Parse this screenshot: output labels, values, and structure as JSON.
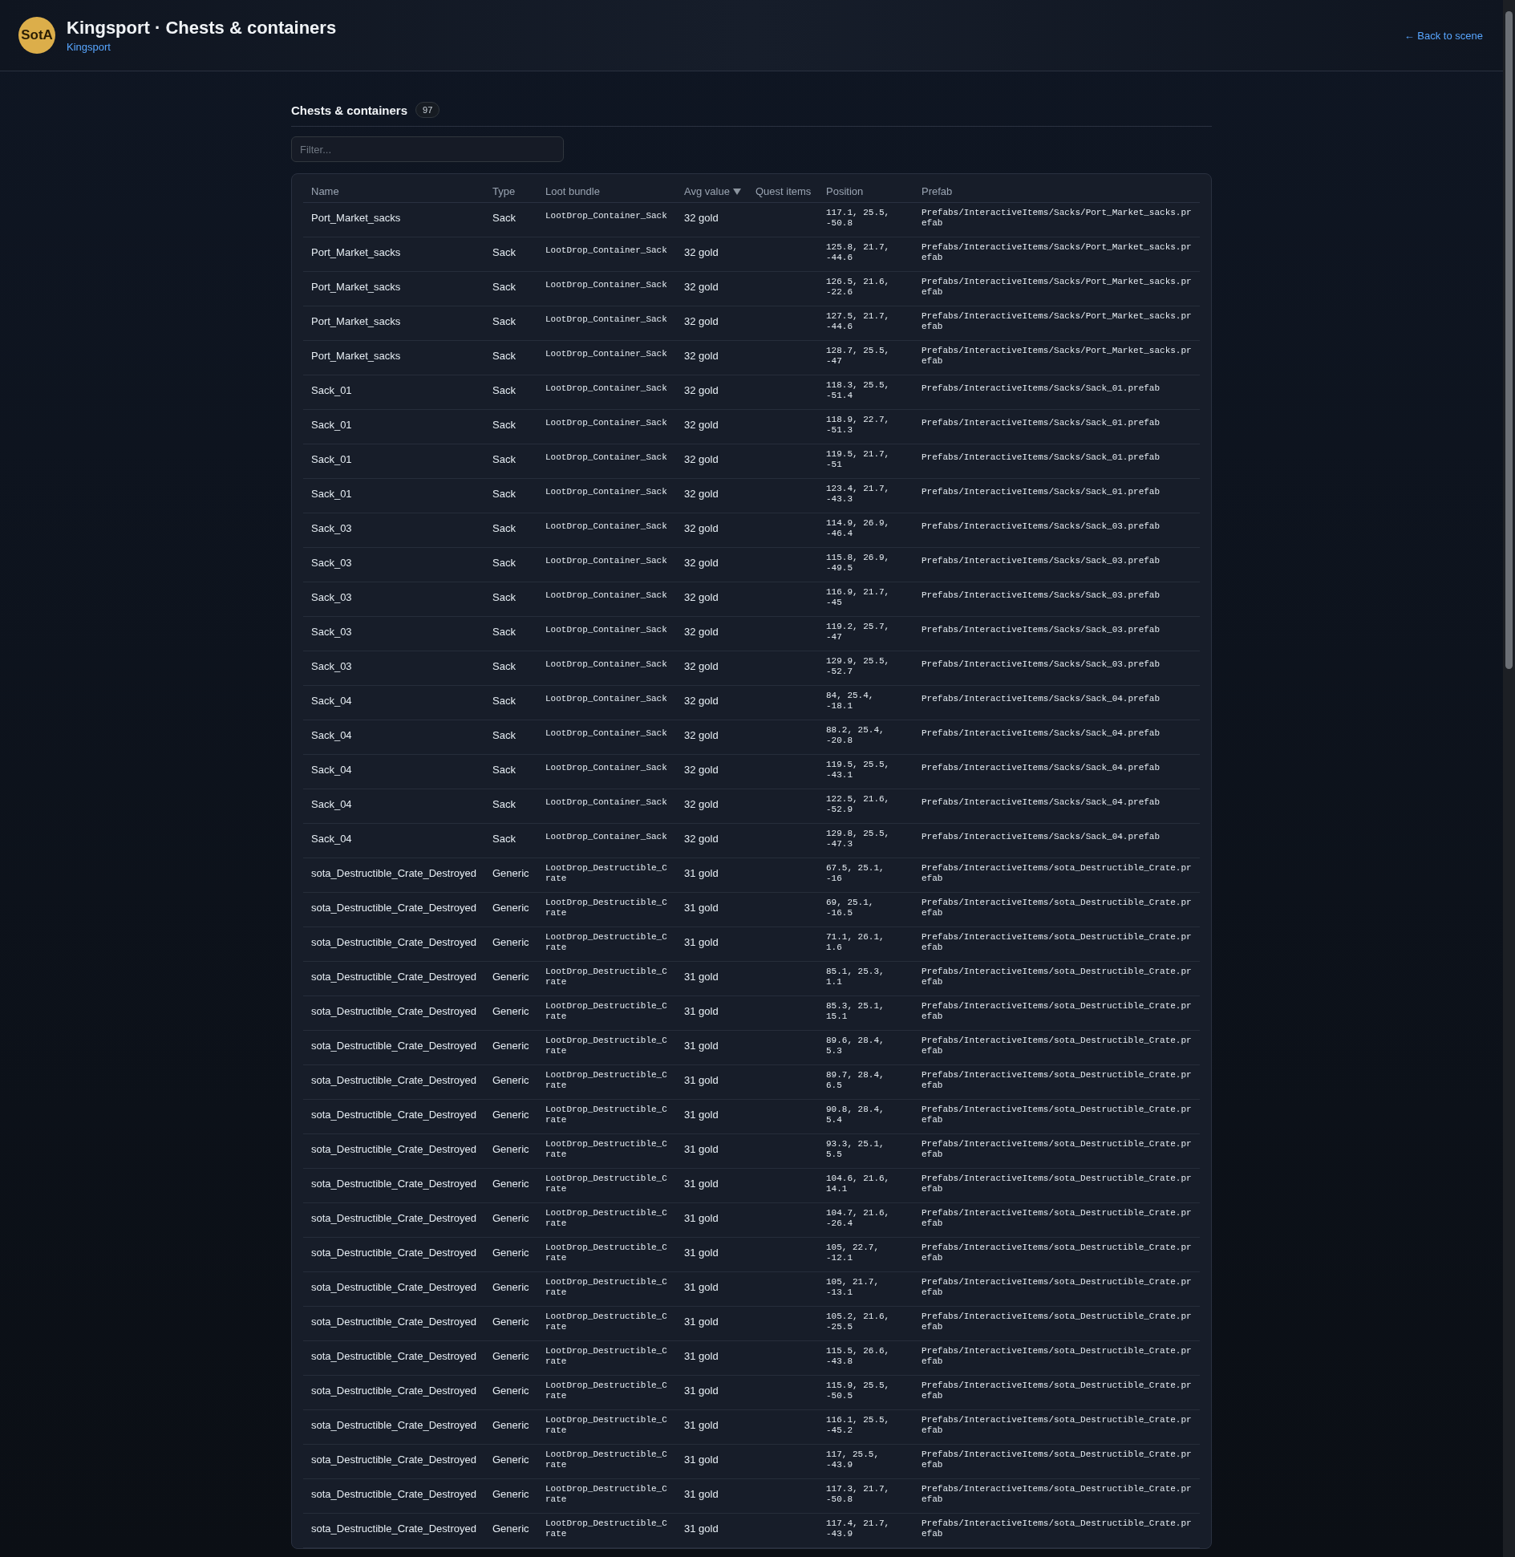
{
  "header": {
    "logo": "SotA",
    "title": "Kingsport · Chests & containers",
    "subtitle": "Kingsport",
    "back_link": "← Back to scene"
  },
  "section": {
    "title": "Chests & containers",
    "count": "97"
  },
  "filter": {
    "placeholder": "Filter..."
  },
  "table": {
    "columns": [
      {
        "label": "Name",
        "sorted": false
      },
      {
        "label": "Type",
        "sorted": false
      },
      {
        "label": "Loot bundle",
        "sorted": false
      },
      {
        "label": "Avg value",
        "sorted": true
      },
      {
        "label": "Quest items",
        "sorted": false
      },
      {
        "label": "Position",
        "sorted": false
      },
      {
        "label": "Prefab",
        "sorted": false
      }
    ],
    "rows": [
      {
        "name": "Port_Market_sacks",
        "type": "Sack",
        "loot_bundle": "LootDrop_Container_Sack",
        "avg_value": "32 gold",
        "position": "117.1, 25.5, -50.8",
        "prefab": "Prefabs/InteractiveItems/Sacks/Port_Market_sacks.prefab"
      },
      {
        "name": "Port_Market_sacks",
        "type": "Sack",
        "loot_bundle": "LootDrop_Container_Sack",
        "avg_value": "32 gold",
        "position": "125.8, 21.7, -44.6",
        "prefab": "Prefabs/InteractiveItems/Sacks/Port_Market_sacks.prefab"
      },
      {
        "name": "Port_Market_sacks",
        "type": "Sack",
        "loot_bundle": "LootDrop_Container_Sack",
        "avg_value": "32 gold",
        "position": "126.5, 21.6, -22.6",
        "prefab": "Prefabs/InteractiveItems/Sacks/Port_Market_sacks.prefab"
      },
      {
        "name": "Port_Market_sacks",
        "type": "Sack",
        "loot_bundle": "LootDrop_Container_Sack",
        "avg_value": "32 gold",
        "position": "127.5, 21.7, -44.6",
        "prefab": "Prefabs/InteractiveItems/Sacks/Port_Market_sacks.prefab"
      },
      {
        "name": "Port_Market_sacks",
        "type": "Sack",
        "loot_bundle": "LootDrop_Container_Sack",
        "avg_value": "32 gold",
        "position": "128.7, 25.5, -47",
        "prefab": "Prefabs/InteractiveItems/Sacks/Port_Market_sacks.prefab"
      },
      {
        "name": "Sack_01",
        "type": "Sack",
        "loot_bundle": "LootDrop_Container_Sack",
        "avg_value": "32 gold",
        "position": "118.3, 25.5, -51.4",
        "prefab": "Prefabs/InteractiveItems/Sacks/Sack_01.prefab"
      },
      {
        "name": "Sack_01",
        "type": "Sack",
        "loot_bundle": "LootDrop_Container_Sack",
        "avg_value": "32 gold",
        "position": "118.9, 22.7, -51.3",
        "prefab": "Prefabs/InteractiveItems/Sacks/Sack_01.prefab"
      },
      {
        "name": "Sack_01",
        "type": "Sack",
        "loot_bundle": "LootDrop_Container_Sack",
        "avg_value": "32 gold",
        "position": "119.5, 21.7, -51",
        "prefab": "Prefabs/InteractiveItems/Sacks/Sack_01.prefab"
      },
      {
        "name": "Sack_01",
        "type": "Sack",
        "loot_bundle": "LootDrop_Container_Sack",
        "avg_value": "32 gold",
        "position": "123.4, 21.7, -43.3",
        "prefab": "Prefabs/InteractiveItems/Sacks/Sack_01.prefab"
      },
      {
        "name": "Sack_03",
        "type": "Sack",
        "loot_bundle": "LootDrop_Container_Sack",
        "avg_value": "32 gold",
        "position": "114.9, 26.9, -46.4",
        "prefab": "Prefabs/InteractiveItems/Sacks/Sack_03.prefab"
      },
      {
        "name": "Sack_03",
        "type": "Sack",
        "loot_bundle": "LootDrop_Container_Sack",
        "avg_value": "32 gold",
        "position": "115.8, 26.9, -49.5",
        "prefab": "Prefabs/InteractiveItems/Sacks/Sack_03.prefab"
      },
      {
        "name": "Sack_03",
        "type": "Sack",
        "loot_bundle": "LootDrop_Container_Sack",
        "avg_value": "32 gold",
        "position": "116.9, 21.7, -45",
        "prefab": "Prefabs/InteractiveItems/Sacks/Sack_03.prefab"
      },
      {
        "name": "Sack_03",
        "type": "Sack",
        "loot_bundle": "LootDrop_Container_Sack",
        "avg_value": "32 gold",
        "position": "119.2, 25.7, -47",
        "prefab": "Prefabs/InteractiveItems/Sacks/Sack_03.prefab"
      },
      {
        "name": "Sack_03",
        "type": "Sack",
        "loot_bundle": "LootDrop_Container_Sack",
        "avg_value": "32 gold",
        "position": "129.9, 25.5, -52.7",
        "prefab": "Prefabs/InteractiveItems/Sacks/Sack_03.prefab"
      },
      {
        "name": "Sack_04",
        "type": "Sack",
        "loot_bundle": "LootDrop_Container_Sack",
        "avg_value": "32 gold",
        "position": "84, 25.4, -18.1",
        "prefab": "Prefabs/InteractiveItems/Sacks/Sack_04.prefab"
      },
      {
        "name": "Sack_04",
        "type": "Sack",
        "loot_bundle": "LootDrop_Container_Sack",
        "avg_value": "32 gold",
        "position": "88.2, 25.4, -20.8",
        "prefab": "Prefabs/InteractiveItems/Sacks/Sack_04.prefab"
      },
      {
        "name": "Sack_04",
        "type": "Sack",
        "loot_bundle": "LootDrop_Container_Sack",
        "avg_value": "32 gold",
        "position": "119.5, 25.5, -43.1",
        "prefab": "Prefabs/InteractiveItems/Sacks/Sack_04.prefab"
      },
      {
        "name": "Sack_04",
        "type": "Sack",
        "loot_bundle": "LootDrop_Container_Sack",
        "avg_value": "32 gold",
        "position": "122.5, 21.6, -52.9",
        "prefab": "Prefabs/InteractiveItems/Sacks/Sack_04.prefab"
      },
      {
        "name": "Sack_04",
        "type": "Sack",
        "loot_bundle": "LootDrop_Container_Sack",
        "avg_value": "32 gold",
        "position": "129.8, 25.5, -47.3",
        "prefab": "Prefabs/InteractiveItems/Sacks/Sack_04.prefab"
      },
      {
        "name": "sota_Destructible_Crate_Destroyed",
        "type": "Generic",
        "loot_bundle": "LootDrop_Destructible_Crate",
        "avg_value": "31 gold",
        "position": "67.5, 25.1, -16",
        "prefab": "Prefabs/InteractiveItems/sota_Destructible_Crate.prefab"
      },
      {
        "name": "sota_Destructible_Crate_Destroyed",
        "type": "Generic",
        "loot_bundle": "LootDrop_Destructible_Crate",
        "avg_value": "31 gold",
        "position": "69, 25.1, -16.5",
        "prefab": "Prefabs/InteractiveItems/sota_Destructible_Crate.prefab"
      },
      {
        "name": "sota_Destructible_Crate_Destroyed",
        "type": "Generic",
        "loot_bundle": "LootDrop_Destructible_Crate",
        "avg_value": "31 gold",
        "position": "71.1, 26.1, 1.6",
        "prefab": "Prefabs/InteractiveItems/sota_Destructible_Crate.prefab"
      },
      {
        "name": "sota_Destructible_Crate_Destroyed",
        "type": "Generic",
        "loot_bundle": "LootDrop_Destructible_Crate",
        "avg_value": "31 gold",
        "position": "85.1, 25.3, 1.1",
        "prefab": "Prefabs/InteractiveItems/sota_Destructible_Crate.prefab"
      },
      {
        "name": "sota_Destructible_Crate_Destroyed",
        "type": "Generic",
        "loot_bundle": "LootDrop_Destructible_Crate",
        "avg_value": "31 gold",
        "position": "85.3, 25.1, 15.1",
        "prefab": "Prefabs/InteractiveItems/sota_Destructible_Crate.prefab"
      },
      {
        "name": "sota_Destructible_Crate_Destroyed",
        "type": "Generic",
        "loot_bundle": "LootDrop_Destructible_Crate",
        "avg_value": "31 gold",
        "position": "89.6, 28.4, 5.3",
        "prefab": "Prefabs/InteractiveItems/sota_Destructible_Crate.prefab"
      },
      {
        "name": "sota_Destructible_Crate_Destroyed",
        "type": "Generic",
        "loot_bundle": "LootDrop_Destructible_Crate",
        "avg_value": "31 gold",
        "position": "89.7, 28.4, 6.5",
        "prefab": "Prefabs/InteractiveItems/sota_Destructible_Crate.prefab"
      },
      {
        "name": "sota_Destructible_Crate_Destroyed",
        "type": "Generic",
        "loot_bundle": "LootDrop_Destructible_Crate",
        "avg_value": "31 gold",
        "position": "90.8, 28.4, 5.4",
        "prefab": "Prefabs/InteractiveItems/sota_Destructible_Crate.prefab"
      },
      {
        "name": "sota_Destructible_Crate_Destroyed",
        "type": "Generic",
        "loot_bundle": "LootDrop_Destructible_Crate",
        "avg_value": "31 gold",
        "position": "93.3, 25.1, 5.5",
        "prefab": "Prefabs/InteractiveItems/sota_Destructible_Crate.prefab"
      },
      {
        "name": "sota_Destructible_Crate_Destroyed",
        "type": "Generic",
        "loot_bundle": "LootDrop_Destructible_Crate",
        "avg_value": "31 gold",
        "position": "104.6, 21.6, 14.1",
        "prefab": "Prefabs/InteractiveItems/sota_Destructible_Crate.prefab"
      },
      {
        "name": "sota_Destructible_Crate_Destroyed",
        "type": "Generic",
        "loot_bundle": "LootDrop_Destructible_Crate",
        "avg_value": "31 gold",
        "position": "104.7, 21.6, -26.4",
        "prefab": "Prefabs/InteractiveItems/sota_Destructible_Crate.prefab"
      },
      {
        "name": "sota_Destructible_Crate_Destroyed",
        "type": "Generic",
        "loot_bundle": "LootDrop_Destructible_Crate",
        "avg_value": "31 gold",
        "position": "105, 22.7, -12.1",
        "prefab": "Prefabs/InteractiveItems/sota_Destructible_Crate.prefab"
      },
      {
        "name": "sota_Destructible_Crate_Destroyed",
        "type": "Generic",
        "loot_bundle": "LootDrop_Destructible_Crate",
        "avg_value": "31 gold",
        "position": "105, 21.7, -13.1",
        "prefab": "Prefabs/InteractiveItems/sota_Destructible_Crate.prefab"
      },
      {
        "name": "sota_Destructible_Crate_Destroyed",
        "type": "Generic",
        "loot_bundle": "LootDrop_Destructible_Crate",
        "avg_value": "31 gold",
        "position": "105.2, 21.6, -25.5",
        "prefab": "Prefabs/InteractiveItems/sota_Destructible_Crate.prefab"
      },
      {
        "name": "sota_Destructible_Crate_Destroyed",
        "type": "Generic",
        "loot_bundle": "LootDrop_Destructible_Crate",
        "avg_value": "31 gold",
        "position": "115.5, 26.6, -43.8",
        "prefab": "Prefabs/InteractiveItems/sota_Destructible_Crate.prefab"
      },
      {
        "name": "sota_Destructible_Crate_Destroyed",
        "type": "Generic",
        "loot_bundle": "LootDrop_Destructible_Crate",
        "avg_value": "31 gold",
        "position": "115.9, 25.5, -50.5",
        "prefab": "Prefabs/InteractiveItems/sota_Destructible_Crate.prefab"
      },
      {
        "name": "sota_Destructible_Crate_Destroyed",
        "type": "Generic",
        "loot_bundle": "LootDrop_Destructible_Crate",
        "avg_value": "31 gold",
        "position": "116.1, 25.5, -45.2",
        "prefab": "Prefabs/InteractiveItems/sota_Destructible_Crate.prefab"
      },
      {
        "name": "sota_Destructible_Crate_Destroyed",
        "type": "Generic",
        "loot_bundle": "LootDrop_Destructible_Crate",
        "avg_value": "31 gold",
        "position": "117, 25.5, -43.9",
        "prefab": "Prefabs/InteractiveItems/sota_Destructible_Crate.prefab"
      },
      {
        "name": "sota_Destructible_Crate_Destroyed",
        "type": "Generic",
        "loot_bundle": "LootDrop_Destructible_Crate",
        "avg_value": "31 gold",
        "position": "117.3, 21.7, -50.8",
        "prefab": "Prefabs/InteractiveItems/sota_Destructible_Crate.prefab"
      },
      {
        "name": "sota_Destructible_Crate_Destroyed",
        "type": "Generic",
        "loot_bundle": "LootDrop_Destructible_Crate",
        "avg_value": "31 gold",
        "position": "117.4, 21.7, -43.9",
        "prefab": "Prefabs/InteractiveItems/sota_Destructible_Crate.prefab"
      }
    ]
  }
}
